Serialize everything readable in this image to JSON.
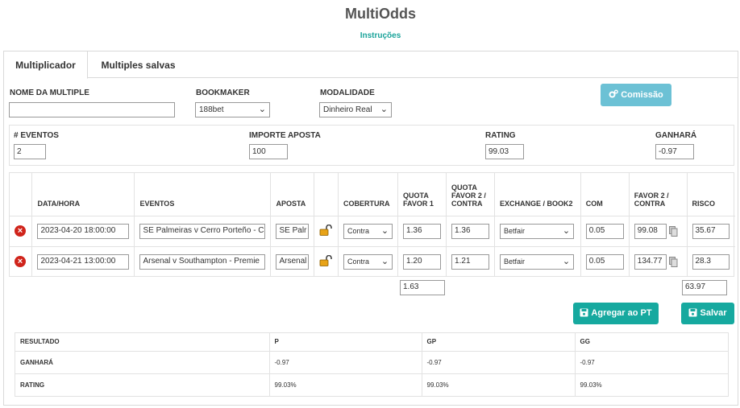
{
  "header": {
    "title": "MultiOdds",
    "subtitle_link": "Instruções"
  },
  "tabs": [
    {
      "label": "Multiplicador"
    },
    {
      "label": "Multiples salvas"
    }
  ],
  "form": {
    "name_label": "NOME DA MULTIPLE",
    "name_value": "",
    "bookmaker_label": "BOOKMAKER",
    "bookmaker_value": "188bet",
    "modalidade_label": "MODALIDADE",
    "modalidade_value": "Dinheiro Real",
    "comissao_button": "Comissão"
  },
  "summary": {
    "eventos_label": "# EVENTOS",
    "eventos_value": "2",
    "importe_label": "IMPORTE APOSTA",
    "importe_value": "100",
    "rating_label": "RATING",
    "rating_value": "99.03",
    "ganhara_label": "GANHARÁ",
    "ganhara_value": "-0.97"
  },
  "events_table": {
    "headers": {
      "datahora": "DATA/HORA",
      "eventos": "EVENTOS",
      "aposta": "APOSTA",
      "cobertura": "COBERTURA",
      "quota_favor1": "QUOTA FAVOR 1",
      "quota_favor2": "QUOTA FAVOR 2 / CONTRA",
      "exchange": "EXCHANGE / BOOK2",
      "com": "COM",
      "favor2": "FAVOR 2 / CONTRA",
      "risco": "RISCO"
    },
    "rows": [
      {
        "datahora": "2023-04-20 18:00:00",
        "evento": "SE Palmeiras v Cerro Porteño - C",
        "aposta": "SE Palr",
        "cobertura": "Contra",
        "quota1": "1.36",
        "quota2": "1.36",
        "exchange": "Betfair",
        "com": "0.05",
        "favor2": "99.08",
        "risco": "35.67"
      },
      {
        "datahora": "2023-04-21 13:00:00",
        "evento": "Arsenal v Southampton - Premie",
        "aposta": "Arsenal",
        "cobertura": "Contra",
        "quota1": "1.20",
        "quota2": "1.21",
        "exchange": "Betfair",
        "com": "0.05",
        "favor2": "134.77",
        "risco": "28.3"
      }
    ],
    "total_quota1": "1.63",
    "total_risco": "63.97"
  },
  "actions": {
    "agregar": "Agregar ao PT",
    "salvar": "Salvar"
  },
  "results": {
    "headers": [
      "RESULTADO",
      "P",
      "GP",
      "GG"
    ],
    "rows": [
      [
        "GANHARÁ",
        "-0.97",
        "-0.97",
        "-0.97"
      ],
      [
        "RATING",
        "99.03%",
        "99.03%",
        "99.03%"
      ]
    ]
  },
  "colors": {
    "teal": "#16a99f",
    "teal_light": "#6cc1d5",
    "accent_text": "#1aa39a",
    "danger": "#d0241b"
  }
}
